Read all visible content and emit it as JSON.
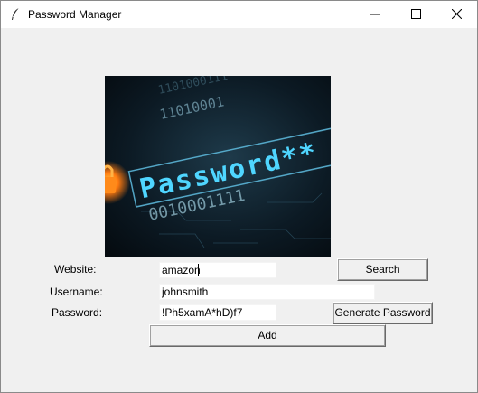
{
  "window": {
    "title": "Password Manager",
    "icon": "feather-icon",
    "controls": [
      "minimize-icon",
      "maximize-icon",
      "close-icon"
    ]
  },
  "hero_image": {
    "text_password": "Password**",
    "binary_top": "1101000111",
    "binary_mid": "11010001",
    "binary_bottom": "0010001111"
  },
  "form": {
    "website_label": "Website:",
    "website_value": "amazon",
    "username_label": "Username:",
    "username_value": "johnsmith",
    "password_label": "Password:",
    "password_value": "!Ph5xamA*hD)f7",
    "search_button": "Search",
    "generate_button": "Generate Password",
    "add_button": "Add"
  },
  "colors": {
    "background": "#f0f0f0",
    "image_dark": "#0b1a24",
    "image_cyan": "#4fd6ff",
    "image_orange": "#ff8a1a"
  }
}
